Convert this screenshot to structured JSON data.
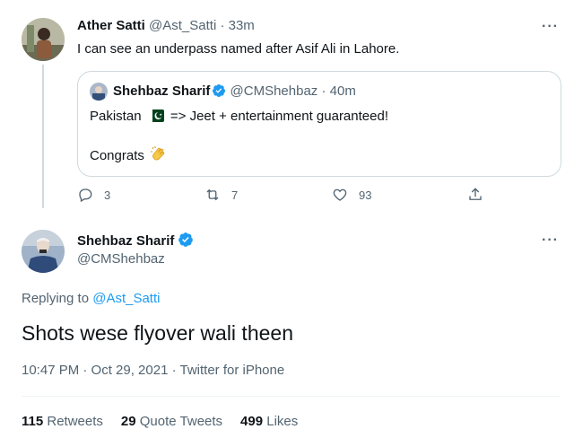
{
  "parent_tweet": {
    "author_name": "Ather Satti",
    "handle": "@Ast_Satti",
    "separator": "·",
    "time": "33m",
    "text": "I can see an underpass named after Asif Ali in Lahore.",
    "quoted": {
      "author_name": "Shehbaz Sharif",
      "handle": "@CMShehbaz",
      "separator": "·",
      "time": "40m",
      "line1_before": "Pakistan",
      "line1_after": "=> Jeet + entertainment guaranteed!",
      "flag_icon": "pakistan-flag-icon",
      "line2": "Congrats",
      "clap_icon": "clapping-hands-icon"
    },
    "actions": {
      "reply_count": "3",
      "retweet_count": "7",
      "like_count": "93"
    }
  },
  "main_tweet": {
    "author_name": "Shehbaz Sharif",
    "handle": "@CMShehbaz",
    "replying_to_label": "Replying to",
    "replying_to_handle": "@Ast_Satti",
    "text": "Shots wese flyover wali theen",
    "timestamp": "10:47 PM · Oct 29, 2021 · Twitter for iPhone",
    "stats": {
      "retweets_count": "115",
      "retweets_label": "Retweets",
      "quote_count": "29",
      "quote_label": "Quote Tweets",
      "likes_count": "499",
      "likes_label": "Likes"
    }
  },
  "colors": {
    "link": "#1d9bf0",
    "muted": "#536471",
    "text": "#0f1419",
    "border": "#cfd9de",
    "verified": "#1d9bf0"
  }
}
